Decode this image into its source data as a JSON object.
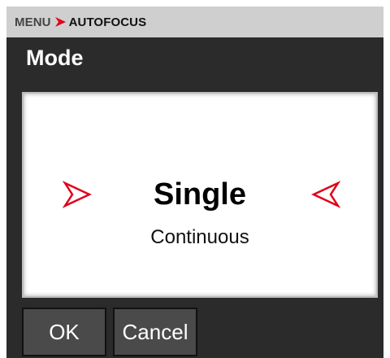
{
  "breadcrumb": {
    "parent": "MENU",
    "current": "AUTOFOCUS",
    "separator_icon": "chevron-right-icon",
    "separator_color": "#e2001a"
  },
  "section": {
    "title": "Mode"
  },
  "mode_selector": {
    "selected": "Single",
    "other_option": "Continuous",
    "left_arrow_icon": "arrow-right-outline-icon",
    "right_arrow_icon": "arrow-left-outline-icon",
    "arrow_color": "#e2001a"
  },
  "buttons": {
    "ok_label": "OK",
    "cancel_label": "Cancel"
  },
  "colors": {
    "header_bar": "#cfcfcf",
    "panel_background": "#2b2b2b",
    "button_background": "#4a4a4a",
    "accent": "#e2001a"
  }
}
